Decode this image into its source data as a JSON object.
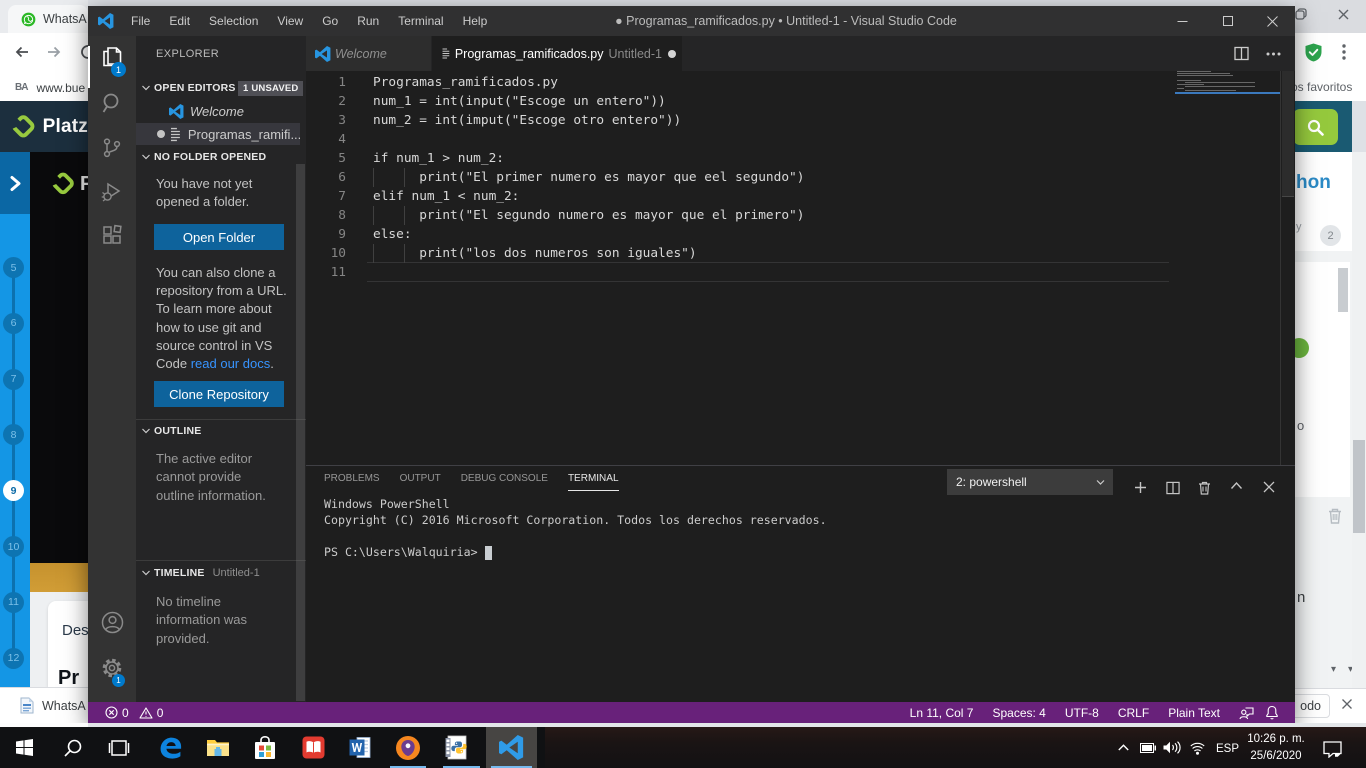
{
  "left_browser": {
    "tab_title": "WhatsA",
    "bookmark_icon": "BA",
    "bookmark_url": "www.bue",
    "brand": "Platz",
    "video_brand": "P",
    "lessons": [
      {
        "n": "5"
      },
      {
        "n": "6"
      },
      {
        "n": "7"
      },
      {
        "n": "8"
      },
      {
        "n": "9",
        "active": true
      },
      {
        "n": "10"
      },
      {
        "n": "11"
      },
      {
        "n": "12"
      }
    ],
    "card_line1": "Des",
    "card_line2": "Pr",
    "download_label": "WhatsA"
  },
  "right_browser": {
    "bookmarks_label": "os favoritos",
    "heading_fragment": "hon",
    "small_fragment": "y",
    "counter": "2",
    "item_fragment_o": "o",
    "item_fragment_n": "n",
    "bottom_fragment": "odo"
  },
  "vscode": {
    "title": "● Programas_ramificados.py • Untitled-1 - Visual Studio Code",
    "menus": [
      {
        "label": "File"
      },
      {
        "label": "Edit"
      },
      {
        "label": "Selection"
      },
      {
        "label": "View"
      },
      {
        "label": "Go"
      },
      {
        "label": "Run"
      },
      {
        "label": "Terminal"
      },
      {
        "label": "Help"
      }
    ],
    "explorer_badge": "1",
    "settings_badge": "1",
    "explorer": {
      "title": "EXPLORER",
      "open_editors_label": "OPEN EDITORS",
      "unsaved_badge": "1 UNSAVED",
      "welcome_item": "Welcome",
      "file_item": "Programas_ramifi...",
      "no_folder_label": "NO FOLDER OPENED",
      "nf_line1": "You have not yet",
      "nf_line2": "opened a folder.",
      "open_folder_btn": "Open Folder",
      "clone_lines": [
        "You can also clone a",
        "repository from a URL.",
        "To learn more about",
        "how to use git and",
        "source control in VS"
      ],
      "clone_last_prefix": "Code ",
      "clone_link": "read our docs",
      "clone_last_suffix": ".",
      "clone_btn": "Clone Repository",
      "outline_label": "OUTLINE",
      "outline_lines": [
        "The active editor",
        "cannot provide",
        "outline information."
      ],
      "timeline_label": "TIMELINE",
      "timeline_extra": "Untitled-1",
      "timeline_lines": [
        "No timeline",
        "information was",
        "provided."
      ]
    },
    "tabs": {
      "welcome": "Welcome",
      "file_name": "Programas_ramificados.py",
      "file_sub": "Untitled-1"
    },
    "code_lines": [
      {
        "num": "1",
        "text": "Programas_ramificados.py"
      },
      {
        "num": "2",
        "text": "num_1 = int(input(\"Escoge un entero\"))"
      },
      {
        "num": "3",
        "text": "num_2 = int(imput(\"Escoge otro entero\"))"
      },
      {
        "num": "4",
        "text": ""
      },
      {
        "num": "5",
        "text": "if num_1 > num_2:"
      },
      {
        "num": "6",
        "text": "      print(\"El primer numero es mayor que eel segundo\")",
        "guides": true
      },
      {
        "num": "7",
        "text": "elif num_1 < num_2:"
      },
      {
        "num": "8",
        "text": "      print(\"El segundo numero es mayor que el primero\")",
        "guides": true
      },
      {
        "num": "9",
        "text": "else:"
      },
      {
        "num": "10",
        "text": "      print(\"los dos numeros son iguales\")",
        "guides": true
      },
      {
        "num": "11",
        "text": ""
      }
    ],
    "panel": {
      "tabs": [
        {
          "label": "PROBLEMS"
        },
        {
          "label": "OUTPUT"
        },
        {
          "label": "DEBUG CONSOLE"
        },
        {
          "label": "TERMINAL",
          "active": true
        }
      ],
      "shell_selector": "2: powershell",
      "terminal_lines": [
        {
          "text": "Windows PowerShell"
        },
        {
          "text": "Copyright (C) 2016 Microsoft Corporation. Todos los derechos reservados."
        },
        {
          "text": ""
        },
        {
          "text": "PS C:\\Users\\Walquiria> "
        }
      ]
    },
    "statusbar": {
      "errors": "0",
      "warnings": "0",
      "line_col": "Ln 11, Col 7",
      "spaces": "Spaces: 4",
      "encoding": "UTF-8",
      "eol": "CRLF",
      "language": "Plain Text"
    }
  },
  "taskbar": {
    "tray_lang": "ESP",
    "tray_time": "10:26 p. m.",
    "tray_date": "25/6/2020"
  }
}
